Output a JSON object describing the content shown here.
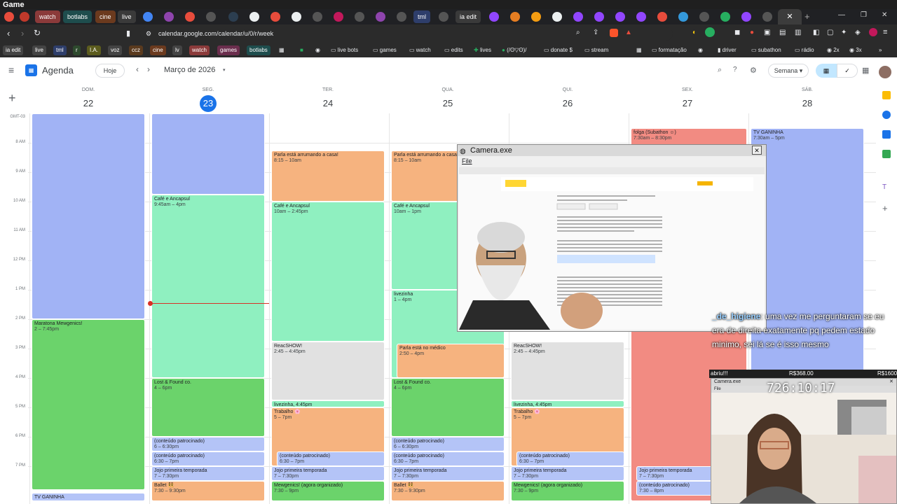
{
  "window": {
    "title": "Game"
  },
  "tabs": [
    {
      "label": "watch",
      "color": "#8b3a3a"
    },
    {
      "label": "botlabs",
      "color": "#1e4d4d"
    },
    {
      "label": "cine",
      "color": "#6b3a1e"
    },
    {
      "label": "live",
      "color": "#3a3a3a"
    },
    {
      "label": "tml",
      "color": "#2e3e6b"
    },
    {
      "label": "ia edit",
      "color": "#3a3a3a"
    }
  ],
  "browser": {
    "url": "calendar.google.com/calendar/u/0/r/week"
  },
  "bookmarks": {
    "chips": [
      {
        "label": "ia edit",
        "color": "#3a3a3a"
      },
      {
        "label": "live",
        "color": "#3a3a3a"
      },
      {
        "label": "tml",
        "color": "#2e3e6b"
      },
      {
        "label": "r",
        "color": "#2e4a2e"
      },
      {
        "label": "I.A.",
        "color": "#5c5c1e"
      },
      {
        "label": "voz",
        "color": "#3a3a3a"
      },
      {
        "label": "ccz",
        "color": "#5a3a1e"
      },
      {
        "label": "cine",
        "color": "#6b3a1e"
      },
      {
        "label": "lv",
        "color": "#3a3a3a"
      },
      {
        "label": "watch",
        "color": "#8b3a3a"
      },
      {
        "label": "games",
        "color": "#6b2e4d"
      },
      {
        "label": "botlabs",
        "color": "#1e4d4d"
      }
    ],
    "items": [
      "live bots",
      "games",
      "watch",
      "edits",
      "lives",
      "(/ʘ▽ʘ)/",
      "donate $",
      "stream",
      "formatação",
      "driver",
      "subathon",
      "rádio",
      "2x",
      "3x"
    ]
  },
  "calendar": {
    "app_name": "Agenda",
    "today_label": "Hoje",
    "month_label": "Março de 2026",
    "view_label": "Semana",
    "timezone": "GMT-03",
    "days": [
      {
        "name": "DOM.",
        "num": "22"
      },
      {
        "name": "SEG.",
        "num": "23"
      },
      {
        "name": "TER.",
        "num": "24"
      },
      {
        "name": "QUA.",
        "num": "25"
      },
      {
        "name": "QUI.",
        "num": "26"
      },
      {
        "name": "SEX.",
        "num": "27"
      },
      {
        "name": "SÁB.",
        "num": "28"
      }
    ],
    "hours": [
      "8 AM",
      "9 AM",
      "10 AM",
      "11 AM",
      "12 PM",
      "1 PM",
      "2 PM",
      "3 PM",
      "4 PM",
      "5 PM",
      "6 PM",
      "7 PM"
    ],
    "events": [
      {
        "day": 0,
        "title": "",
        "time": "",
        "start": 7.0,
        "end": 14.0,
        "color": "blue"
      },
      {
        "day": 0,
        "title": "Maratona Mewgenics!",
        "time": "2 – 7:45pm",
        "start": 14.0,
        "end": 19.8,
        "color": "green"
      },
      {
        "day": 0,
        "title": "TV GANINHA",
        "time": "",
        "start": 19.9,
        "end": 20.2,
        "color": "lav"
      },
      {
        "day": 1,
        "title": "",
        "time": "",
        "start": 7.0,
        "end": 9.75,
        "color": "blue"
      },
      {
        "day": 1,
        "title": "Café e Ancapsul",
        "time": "9:45am – 4pm",
        "start": 9.75,
        "end": 16.0,
        "color": "mint"
      },
      {
        "day": 1,
        "title": "Lost & Found co.",
        "time": "4 – 6pm",
        "start": 16.0,
        "end": 18.0,
        "color": "green"
      },
      {
        "day": 1,
        "title": "(conteúdo patrocinado)",
        "time": "6 – 6:30pm",
        "start": 18.0,
        "end": 18.5,
        "color": "lav"
      },
      {
        "day": 1,
        "title": "(conteúdo patrocinado)",
        "time": "6:30 – 7pm",
        "start": 18.5,
        "end": 19.0,
        "color": "lav"
      },
      {
        "day": 1,
        "title": "Jojo primeira temporada",
        "time": "7 – 7:30pm",
        "start": 19.0,
        "end": 19.5,
        "color": "lav"
      },
      {
        "day": 1,
        "title": "Ballet 👯",
        "time": "7:30 – 9:30pm",
        "start": 19.5,
        "end": 20.2,
        "color": "orange"
      },
      {
        "day": 2,
        "title": "Parla está arrumando a casa!",
        "time": "8:15 – 10am",
        "start": 8.25,
        "end": 10.0,
        "color": "orange"
      },
      {
        "day": 2,
        "title": "Café e Ancapsul",
        "time": "10am – 2:45pm",
        "start": 10.0,
        "end": 14.75,
        "color": "mint"
      },
      {
        "day": 2,
        "title": "ReacSHOW!",
        "time": "2:45 – 4:45pm",
        "start": 14.75,
        "end": 16.75,
        "color": "grey"
      },
      {
        "day": 2,
        "title": "livezinha, 4:45pm",
        "time": "",
        "start": 16.75,
        "end": 17.0,
        "color": "mint"
      },
      {
        "day": 2,
        "title": "Trabalho 🌸",
        "time": "5 – 7pm",
        "start": 17.0,
        "end": 19.0,
        "color": "orange"
      },
      {
        "day": 2,
        "title": "(conteúdo patrocinado)",
        "time": "6:30 – 7pm",
        "start": 18.5,
        "end": 19.0,
        "color": "lav",
        "inset": true
      },
      {
        "day": 2,
        "title": "Jojo primeira temporada",
        "time": "7 – 7:30pm",
        "start": 19.0,
        "end": 19.5,
        "color": "lav"
      },
      {
        "day": 2,
        "title": "Mewgenics! (agora organizado)",
        "time": "7:30 – 9pm",
        "start": 19.5,
        "end": 20.2,
        "color": "green"
      },
      {
        "day": 3,
        "title": "Parla está arrumando a casa!",
        "time": "8:15 – 10am",
        "start": 8.25,
        "end": 10.0,
        "color": "orange"
      },
      {
        "day": 3,
        "title": "Café e Ancapsul",
        "time": "10am – 1pm",
        "start": 10.0,
        "end": 13.0,
        "color": "mint"
      },
      {
        "day": 3,
        "title": "livezinha",
        "time": "1 – 4pm",
        "start": 13.0,
        "end": 16.0,
        "color": "mint"
      },
      {
        "day": 3,
        "title": "Parla está no médico",
        "time": "2:50 – 4pm",
        "start": 14.83,
        "end": 16.0,
        "color": "orange",
        "inset": true
      },
      {
        "day": 3,
        "title": "Lost & Found co.",
        "time": "4 – 6pm",
        "start": 16.0,
        "end": 18.0,
        "color": "green"
      },
      {
        "day": 3,
        "title": "(conteúdo patrocinado)",
        "time": "6 – 6:30pm",
        "start": 18.0,
        "end": 18.5,
        "color": "lav"
      },
      {
        "day": 3,
        "title": "(conteúdo patrocinado)",
        "time": "6:30 – 7pm",
        "start": 18.5,
        "end": 19.0,
        "color": "lav"
      },
      {
        "day": 3,
        "title": "Jojo primeira temporada",
        "time": "7 – 7:30pm",
        "start": 19.0,
        "end": 19.5,
        "color": "lav"
      },
      {
        "day": 3,
        "title": "Ballet 👯",
        "time": "7:30 – 9:30pm",
        "start": 19.5,
        "end": 20.2,
        "color": "orange"
      },
      {
        "day": 4,
        "title": "ReacSHOW!",
        "time": "2:45 – 4:45pm",
        "start": 14.75,
        "end": 16.75,
        "color": "grey"
      },
      {
        "day": 4,
        "title": "livezinha, 4:45pm",
        "time": "",
        "start": 16.75,
        "end": 17.0,
        "color": "mint"
      },
      {
        "day": 4,
        "title": "Trabalho 🌸",
        "time": "5 – 7pm",
        "start": 17.0,
        "end": 19.0,
        "color": "orange"
      },
      {
        "day": 4,
        "title": "(conteúdo patrocinado)",
        "time": "6:30 – 7pm",
        "start": 18.5,
        "end": 19.0,
        "color": "lav",
        "inset": true
      },
      {
        "day": 4,
        "title": "Jojo primeira temporada",
        "time": "7 – 7:30pm",
        "start": 19.0,
        "end": 19.5,
        "color": "lav"
      },
      {
        "day": 4,
        "title": "Mewgenics! (agora organizado)",
        "time": "7:30 – 9pm",
        "start": 19.5,
        "end": 20.2,
        "color": "green"
      },
      {
        "day": 5,
        "title": "folga (Subathon ☺)",
        "time": "7:30am – 8:30pm",
        "start": 7.5,
        "end": 20.2,
        "color": "red"
      },
      {
        "day": 5,
        "title": "Jojo primeira temporada",
        "time": "7 – 7:30pm",
        "start": 19.0,
        "end": 19.5,
        "color": "lav",
        "inset": true
      },
      {
        "day": 5,
        "title": "(conteúdo patrocinado)",
        "time": "7:30 – 8pm",
        "start": 19.5,
        "end": 20.0,
        "color": "lav",
        "inset": true
      },
      {
        "day": 6,
        "title": "TV GANINHA",
        "time": "7:30am – 5pm",
        "start": 7.5,
        "end": 17.0,
        "color": "blue"
      }
    ]
  },
  "camera_window": {
    "title": "Camera.exe",
    "menu_file": "File"
  },
  "overlay": {
    "chat_user": "_de_higiene",
    "chat_text": ": uma vez me perguntaram se eu era de direita exatamente pq pedem estado minimo, sei lá se é isso mesmo",
    "donation_label": "abriu!!!",
    "donation_goal_current": "R$368.00",
    "donation_goal_target": "R$1600",
    "timer": "726:10:17",
    "cam2_title": "Camera.exe",
    "cam2_menu": "File"
  }
}
